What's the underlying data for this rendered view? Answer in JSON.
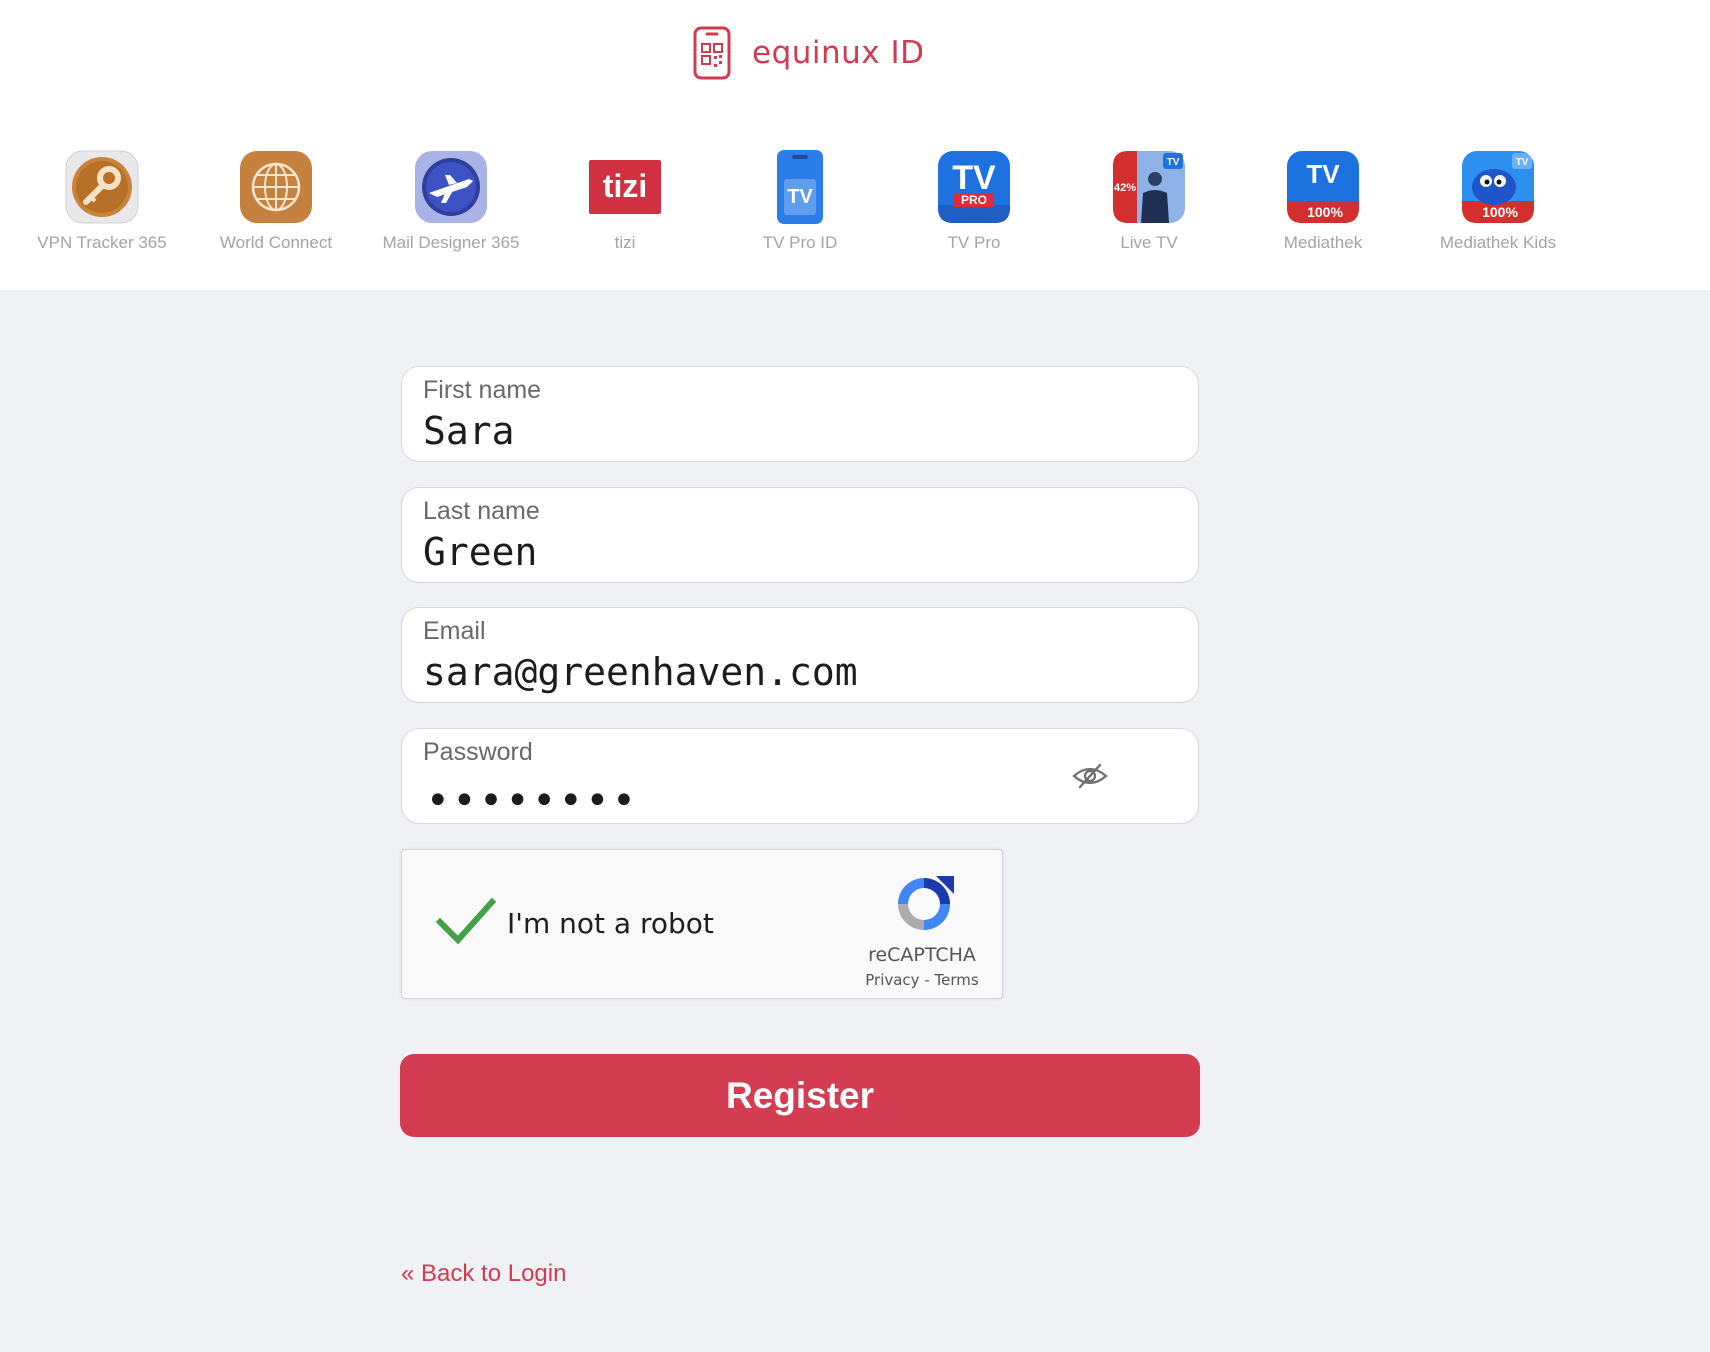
{
  "header": {
    "brand_name": "equinux ID",
    "apps": [
      {
        "label": "VPN Tracker 365",
        "icon": "key-icon"
      },
      {
        "label": "World Connect",
        "icon": "globe-icon"
      },
      {
        "label": "Mail Designer 365",
        "icon": "airplane-icon"
      },
      {
        "label": "tizi",
        "icon": "tizi-logo-icon",
        "icon_text": "tizi"
      },
      {
        "label": "TV Pro ID",
        "icon": "phone-tv-icon",
        "icon_text": "TV"
      },
      {
        "label": "TV Pro",
        "icon": "tv-pro-icon",
        "icon_text": "TV",
        "badge_text": "PRO"
      },
      {
        "label": "Live TV",
        "icon": "live-tv-icon",
        "icon_text": "TV",
        "badge_text": "42%"
      },
      {
        "label": "Mediathek",
        "icon": "mediathek-icon",
        "icon_text": "TV",
        "badge_text": "100%"
      },
      {
        "label": "Mediathek Kids",
        "icon": "mediathek-kids-icon",
        "icon_text": "TV",
        "badge_text": "100%"
      }
    ]
  },
  "form": {
    "first_name": {
      "label": "First name",
      "value": "Sara"
    },
    "last_name": {
      "label": "Last name",
      "value": "Green"
    },
    "email": {
      "label": "Email",
      "value": "sara@greenhaven.com"
    },
    "password": {
      "label": "Password",
      "masked_value": "••••••••"
    }
  },
  "captcha": {
    "label": "I'm not a robot",
    "brand": "reCAPTCHA",
    "privacy": "Privacy",
    "separator": "-",
    "terms": "Terms",
    "checked": true
  },
  "actions": {
    "register_label": "Register",
    "back_label": "« Back to Login"
  },
  "colors": {
    "accent": "#d33c51",
    "page_background": "#f0f1f5",
    "check_green": "#43a047"
  }
}
